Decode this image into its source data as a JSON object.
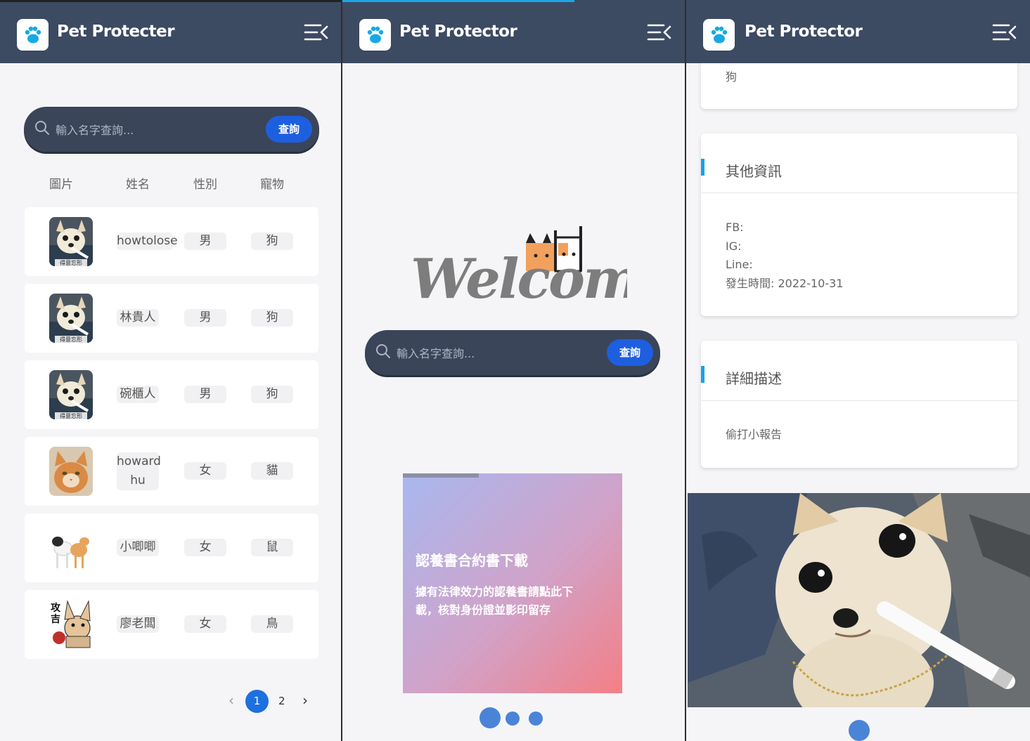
{
  "screen1": {
    "app_title": "Pet Protecter",
    "search": {
      "placeholder": "輸入名字查詢...",
      "button": "查詢"
    },
    "columns": [
      "圖片",
      "姓名",
      "性別",
      "寵物"
    ],
    "rows": [
      {
        "name": "howtolose",
        "gender": "男",
        "pet": "狗"
      },
      {
        "name": "林貴人",
        "gender": "男",
        "pet": "狗"
      },
      {
        "name": "碗櫃人",
        "gender": "男",
        "pet": "狗"
      },
      {
        "name_line1": "howard",
        "name_line2": "hu",
        "gender": "女",
        "pet": "貓"
      },
      {
        "name": "小唧唧",
        "gender": "女",
        "pet": "鼠"
      },
      {
        "name": "廖老闆",
        "gender": "女",
        "pet": "鳥"
      }
    ],
    "thumb_caption": "得意忘形",
    "sticker_text_1": "攻",
    "sticker_text_2": "吉",
    "pagination": {
      "prev": "‹",
      "pages": [
        "1",
        "2"
      ],
      "current": "1",
      "next": "›"
    }
  },
  "screen2": {
    "app_title": "Pet Protector",
    "welcome": "Welcome",
    "search": {
      "placeholder": "輸入名字查詢...",
      "button": "查詢"
    },
    "carousel": {
      "title": "認養書合約書下載",
      "desc_line1": "據有法律效力的認養書請點此下",
      "desc_line2": "載，核對身份證並影印留存",
      "slide_count": 3,
      "active_index": 0
    }
  },
  "screen3": {
    "app_title": "Pet Protector",
    "pet_value": "狗",
    "other_info": {
      "title": "其他資訊",
      "fb": "FB:",
      "ig": "IG:",
      "line": "Line:",
      "time": "發生時間: 2022-10-31"
    },
    "description": {
      "title": "詳細描述",
      "text": "偷打小報告"
    }
  },
  "colors": {
    "header": "#3c4a62",
    "accent": "#1e5fe0",
    "section_bar": "#17a2e8",
    "dot": "#4a84d6"
  }
}
